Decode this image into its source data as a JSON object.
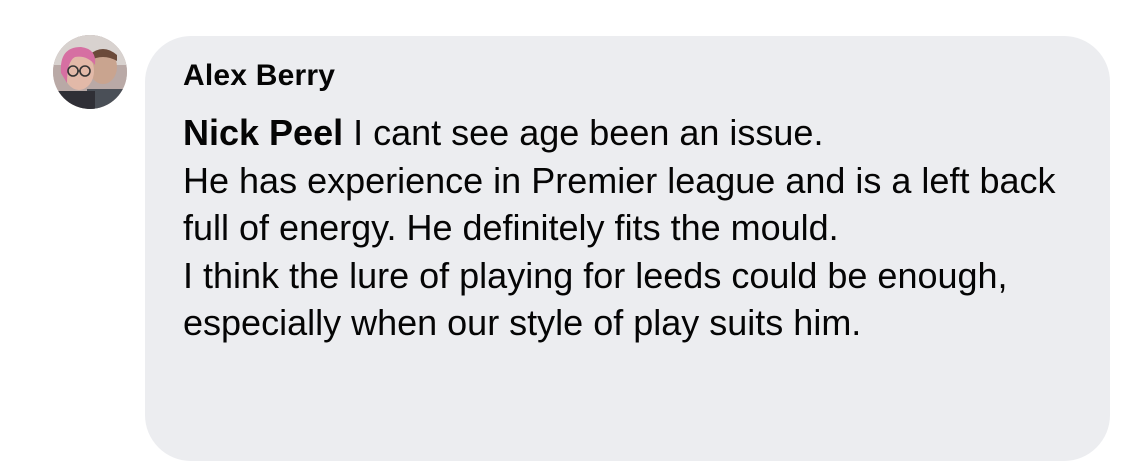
{
  "comment": {
    "author": "Alex Berry",
    "mention": "Nick Peel",
    "lines": [
      " I cant see age been an issue.",
      "He has experience in Premier league and is a left back full of energy. He definitely fits the mould.",
      "I think the lure of playing for leeds could be enough, especially when our style of play suits him."
    ]
  },
  "colors": {
    "bubble": "#ecedf0",
    "text": "#050505"
  },
  "icons": {
    "avatar": "profile-photo-avatar"
  }
}
